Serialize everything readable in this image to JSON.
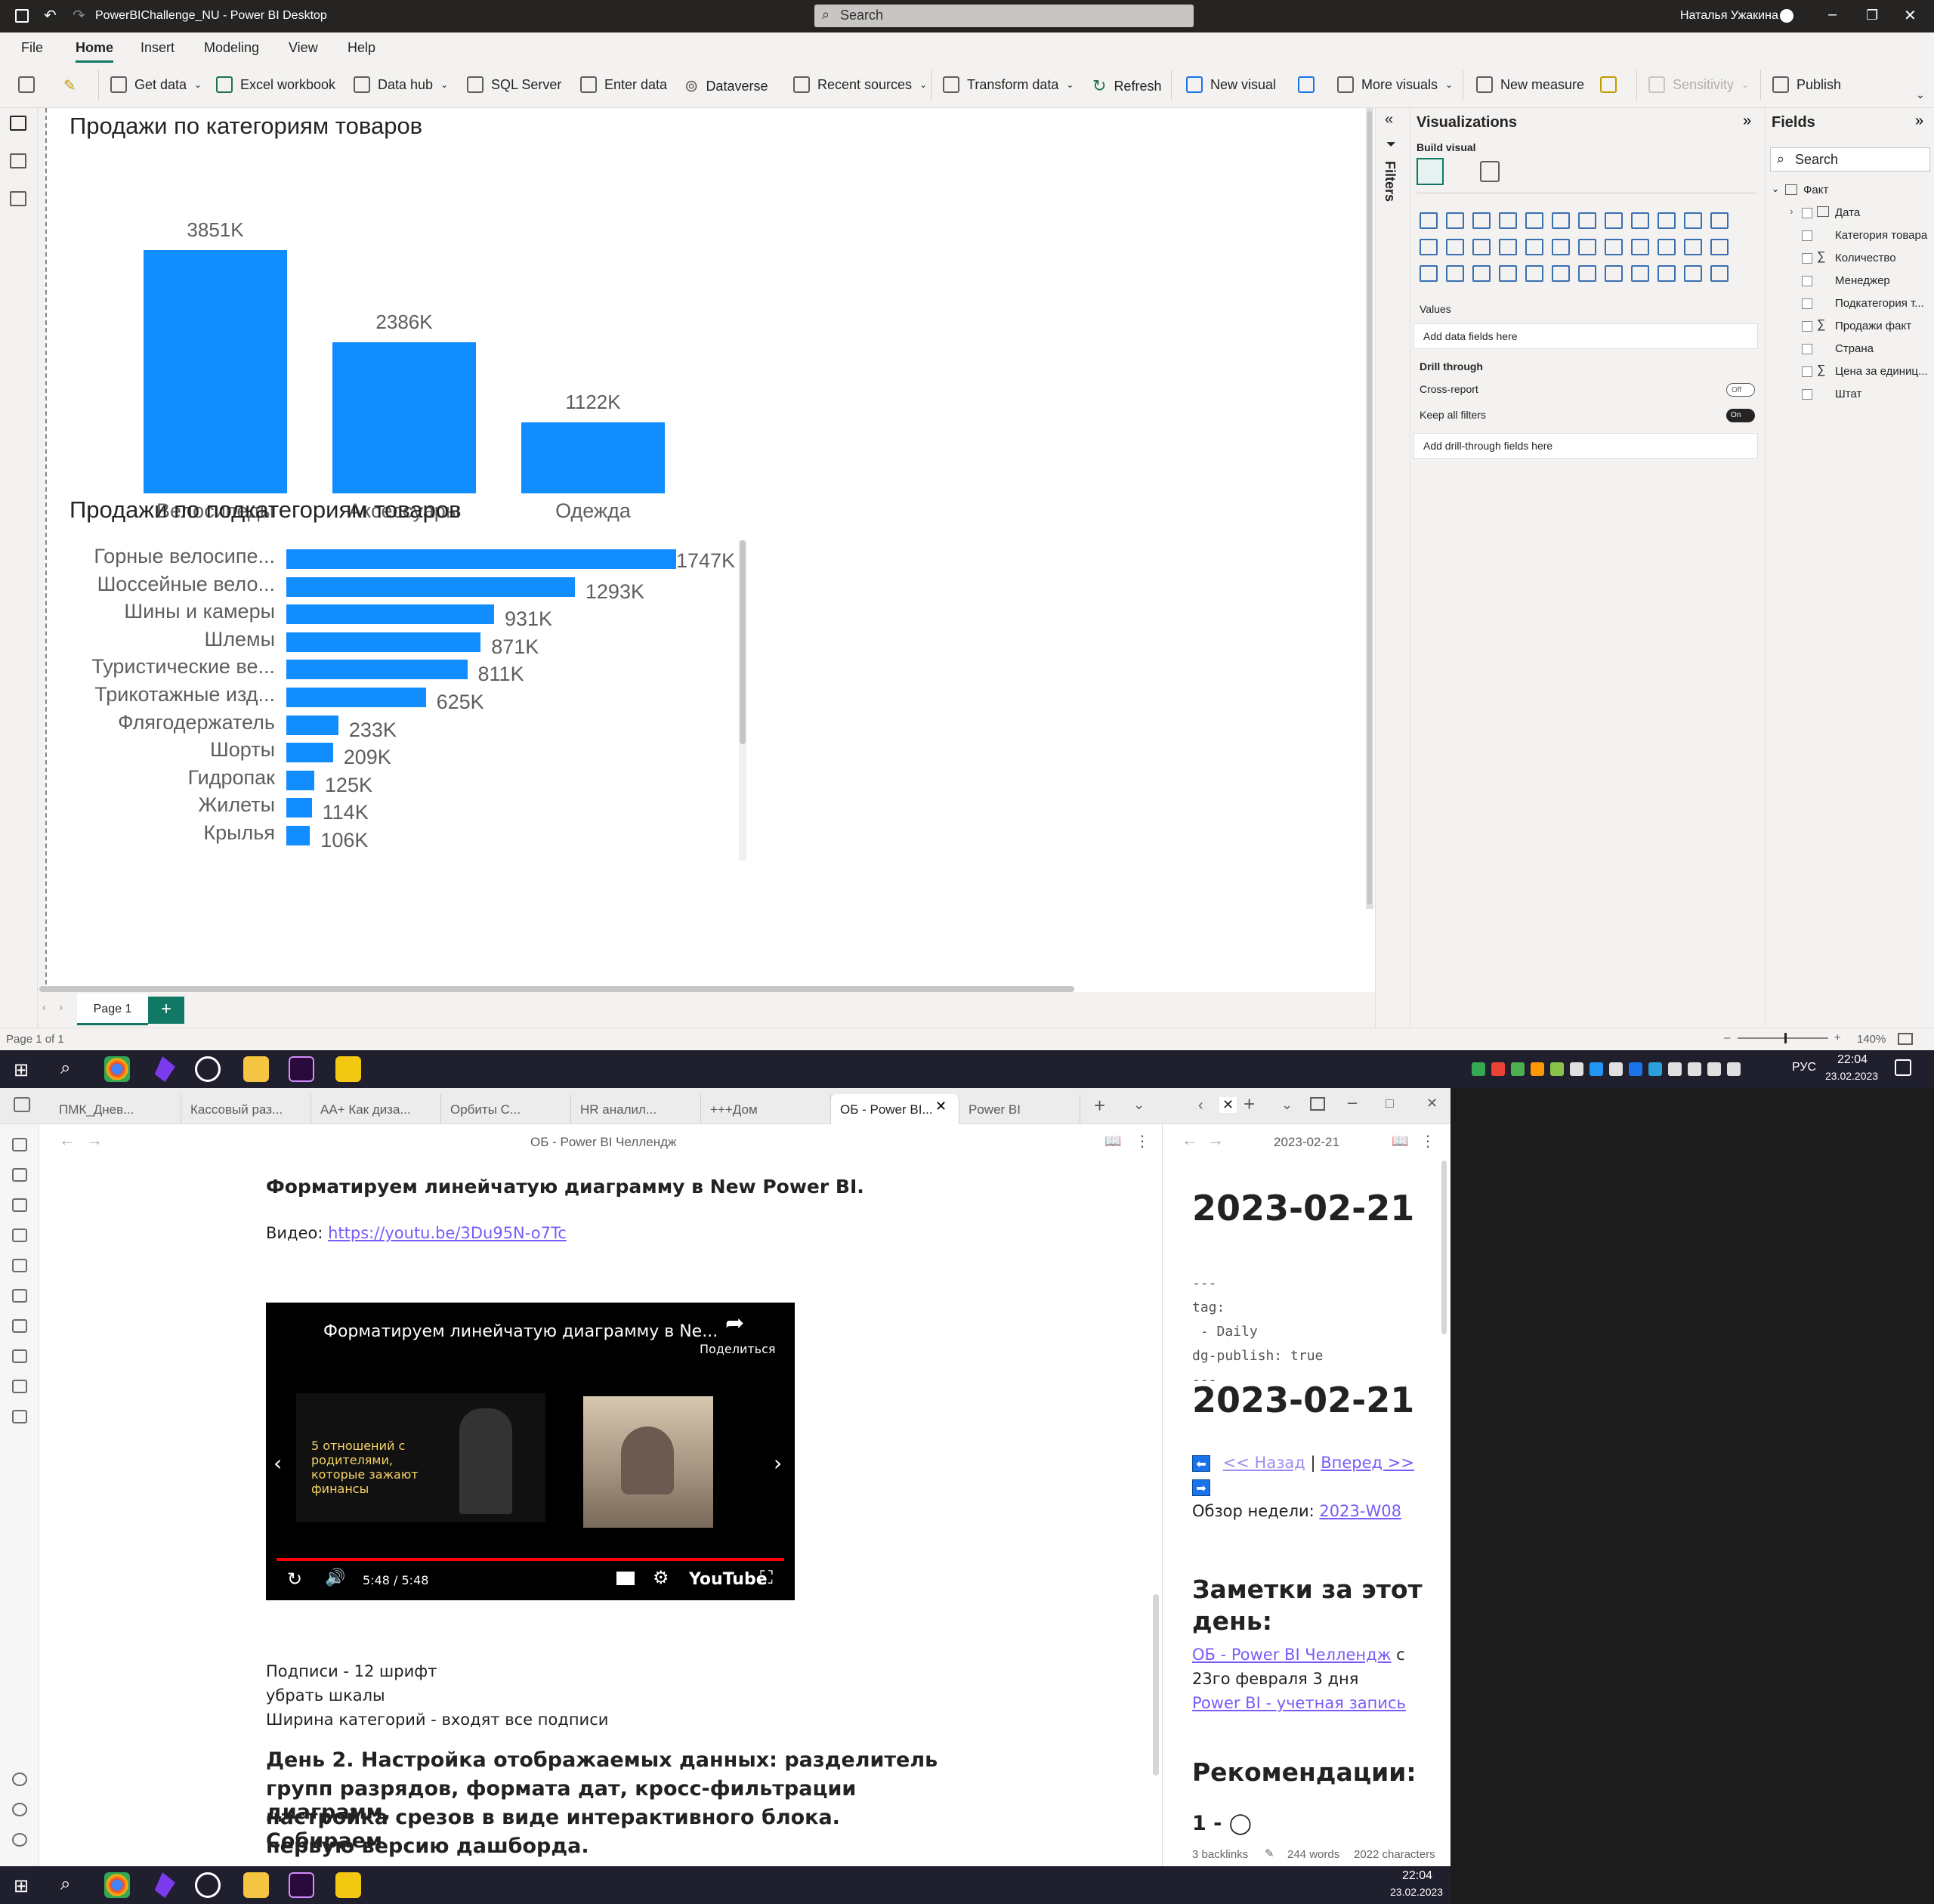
{
  "pbi": {
    "window_title": "PowerBIChallenge_NU - Power BI Desktop",
    "search_placeholder": "Search",
    "user_name": "Наталья Ужакина",
    "ribbon_tabs": [
      "File",
      "Home",
      "Insert",
      "Modeling",
      "View",
      "Help"
    ],
    "ribbon_buttons": {
      "get_data": "Get data",
      "excel": "Excel workbook",
      "data_hub": "Data hub",
      "sql": "SQL Server",
      "enter_data": "Enter data",
      "dataverse": "Dataverse",
      "recent": "Recent sources",
      "transform": "Transform data",
      "refresh": "Refresh",
      "new_visual": "New visual",
      "more_visuals": "More visuals",
      "new_measure": "New measure",
      "sensitivity": "Sensitivity",
      "publish": "Publish"
    },
    "page_tab": "Page 1",
    "add_page": "+",
    "status_left": "Page 1 of 1",
    "zoom": "140%",
    "filters_label": "Filters",
    "viz": {
      "title": "Visualizations",
      "build_visual": "Build visual",
      "values_label": "Values",
      "values_placeholder": "Add data fields here",
      "drill_through": "Drill through",
      "cross_report": "Cross-report",
      "cross_report_state": "Off",
      "keep_all_filters": "Keep all filters",
      "keep_state": "On",
      "drill_placeholder": "Add drill-through fields here"
    },
    "fields": {
      "title": "Fields",
      "search_placeholder": "Search",
      "table": "Факт",
      "items": [
        "Дата",
        "Категория товара",
        "Количество",
        "Менеджер",
        "Подкатегория т...",
        "Продажи факт",
        "Страна",
        "Цена за единиц...",
        "Штат"
      ]
    }
  },
  "chart_data": [
    {
      "type": "bar",
      "title": "Продажи по категориям товаров",
      "categories": [
        "Велосипеды",
        "Аксессуары",
        "Одежда"
      ],
      "values": [
        3851,
        2386,
        1122
      ],
      "value_labels": [
        "3851K",
        "2386K",
        "1122K"
      ],
      "unit": "K",
      "color": "#118dff"
    },
    {
      "type": "bar",
      "orientation": "horizontal",
      "title": "Продажи по подкатегориям товаров",
      "categories": [
        "Горные велосипе...",
        "Шоссейные вело...",
        "Шины и камеры",
        "Шлемы",
        "Туристические ве...",
        "Трикотажные изд...",
        "Флягодержатель",
        "Шорты",
        "Гидропак",
        "Жилеты",
        "Крылья"
      ],
      "values": [
        1747,
        1293,
        931,
        871,
        811,
        625,
        233,
        209,
        125,
        114,
        106
      ],
      "value_labels": [
        "1747K",
        "1293K",
        "931K",
        "871K",
        "811K",
        "625K",
        "233K",
        "209K",
        "125K",
        "114K",
        "106K"
      ],
      "unit": "K",
      "color": "#118dff"
    }
  ],
  "taskbar": {
    "time": "22:04",
    "date": "23.02.2023",
    "lang": "РУС"
  },
  "obsidian": {
    "tabs": [
      "ПМК_Днев...",
      "Кассовый раз...",
      "AA+ Как диза...",
      "Орбиты С...",
      "HR аналил...",
      "+++Дом",
      "ОБ - Power BI...",
      "Power BI"
    ],
    "left_title": "ОБ - Power BI Челлендж",
    "right_title": "2023-02-21",
    "doc": {
      "h1": "Форматируем линейчатую диаграмму в New Power BI.",
      "video_prefix": "Видео: ",
      "video_link": "https://youtu.be/3Du95N-o7Tc",
      "video_title": "Форматируем линейчатую диаграмму в Ne...",
      "video_share": "Поделиться",
      "video_thumb_text": "5 отношений с родителями, которые зажают финансы",
      "video_time": "5:48 / 5:48",
      "video_brand": "YouTube",
      "line1": "Подписи - 12 шрифт",
      "line2": "убрать шкалы",
      "line3": "Ширина категорий - входят все подписи",
      "h2a": "День 2. Настройка отображаемых данных: разделитель",
      "h2b": "групп разрядов, формата дат, кросс-фильтрации диаграмм,",
      "h2c": "настройка срезов в виде интерактивного блока. Собираем",
      "h2d": "первую версию дашборда."
    },
    "right": {
      "h1": "2023-02-21",
      "fm1": "---",
      "fm2": "tag:",
      "fm3": " - Daily",
      "fm4": "dg-publish: true",
      "fm5": "---",
      "h1b": "2023-02-21",
      "back": "<<  Назад",
      "sep": "|",
      "fwd": "Вперед >>",
      "week_prefix": "Обзор недели: ",
      "week_link": "2023-W08",
      "notes_h": "Заметки за этот",
      "notes_h2": "день:",
      "note_link": "ОБ - Power BI Челлендж",
      "note_rest1": " с",
      "note_rest2": "23го февраля 3 дня",
      "note_link2": "Power BI - учетная запись",
      "rec_h": "Рекомендации:",
      "rec1": "1 - ◯"
    },
    "status": {
      "backlinks": "3 backlinks",
      "words": "244 words",
      "chars": "2022 characters"
    }
  }
}
